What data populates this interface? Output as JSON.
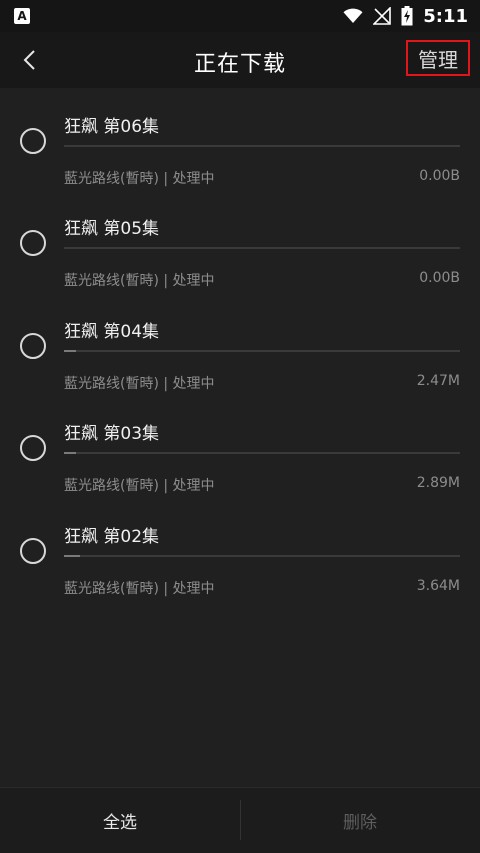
{
  "statusbar": {
    "app_icon_letter": "A",
    "time": "5:11"
  },
  "header": {
    "title": "正在下载",
    "manage_label": "管理"
  },
  "downloads": [
    {
      "title": "狂飙 第06集",
      "subtitle": "藍光路线(暫時) | 处理中",
      "size": "0.00B",
      "progress": 0.0
    },
    {
      "title": "狂飙 第05集",
      "subtitle": "藍光路线(暫時) | 处理中",
      "size": "0.00B",
      "progress": 0.0
    },
    {
      "title": "狂飙 第04集",
      "subtitle": "藍光路线(暫時) | 处理中",
      "size": "2.47M",
      "progress": 0.03
    },
    {
      "title": "狂飙 第03集",
      "subtitle": "藍光路线(暫時) | 处理中",
      "size": "2.89M",
      "progress": 0.03
    },
    {
      "title": "狂飙 第02集",
      "subtitle": "藍光路线(暫時) | 处理中",
      "size": "3.64M",
      "progress": 0.04
    }
  ],
  "bottom": {
    "select_all_label": "全选",
    "delete_label": "删除"
  },
  "colors": {
    "background": "#202020",
    "manage_highlight": "#e0161b"
  }
}
